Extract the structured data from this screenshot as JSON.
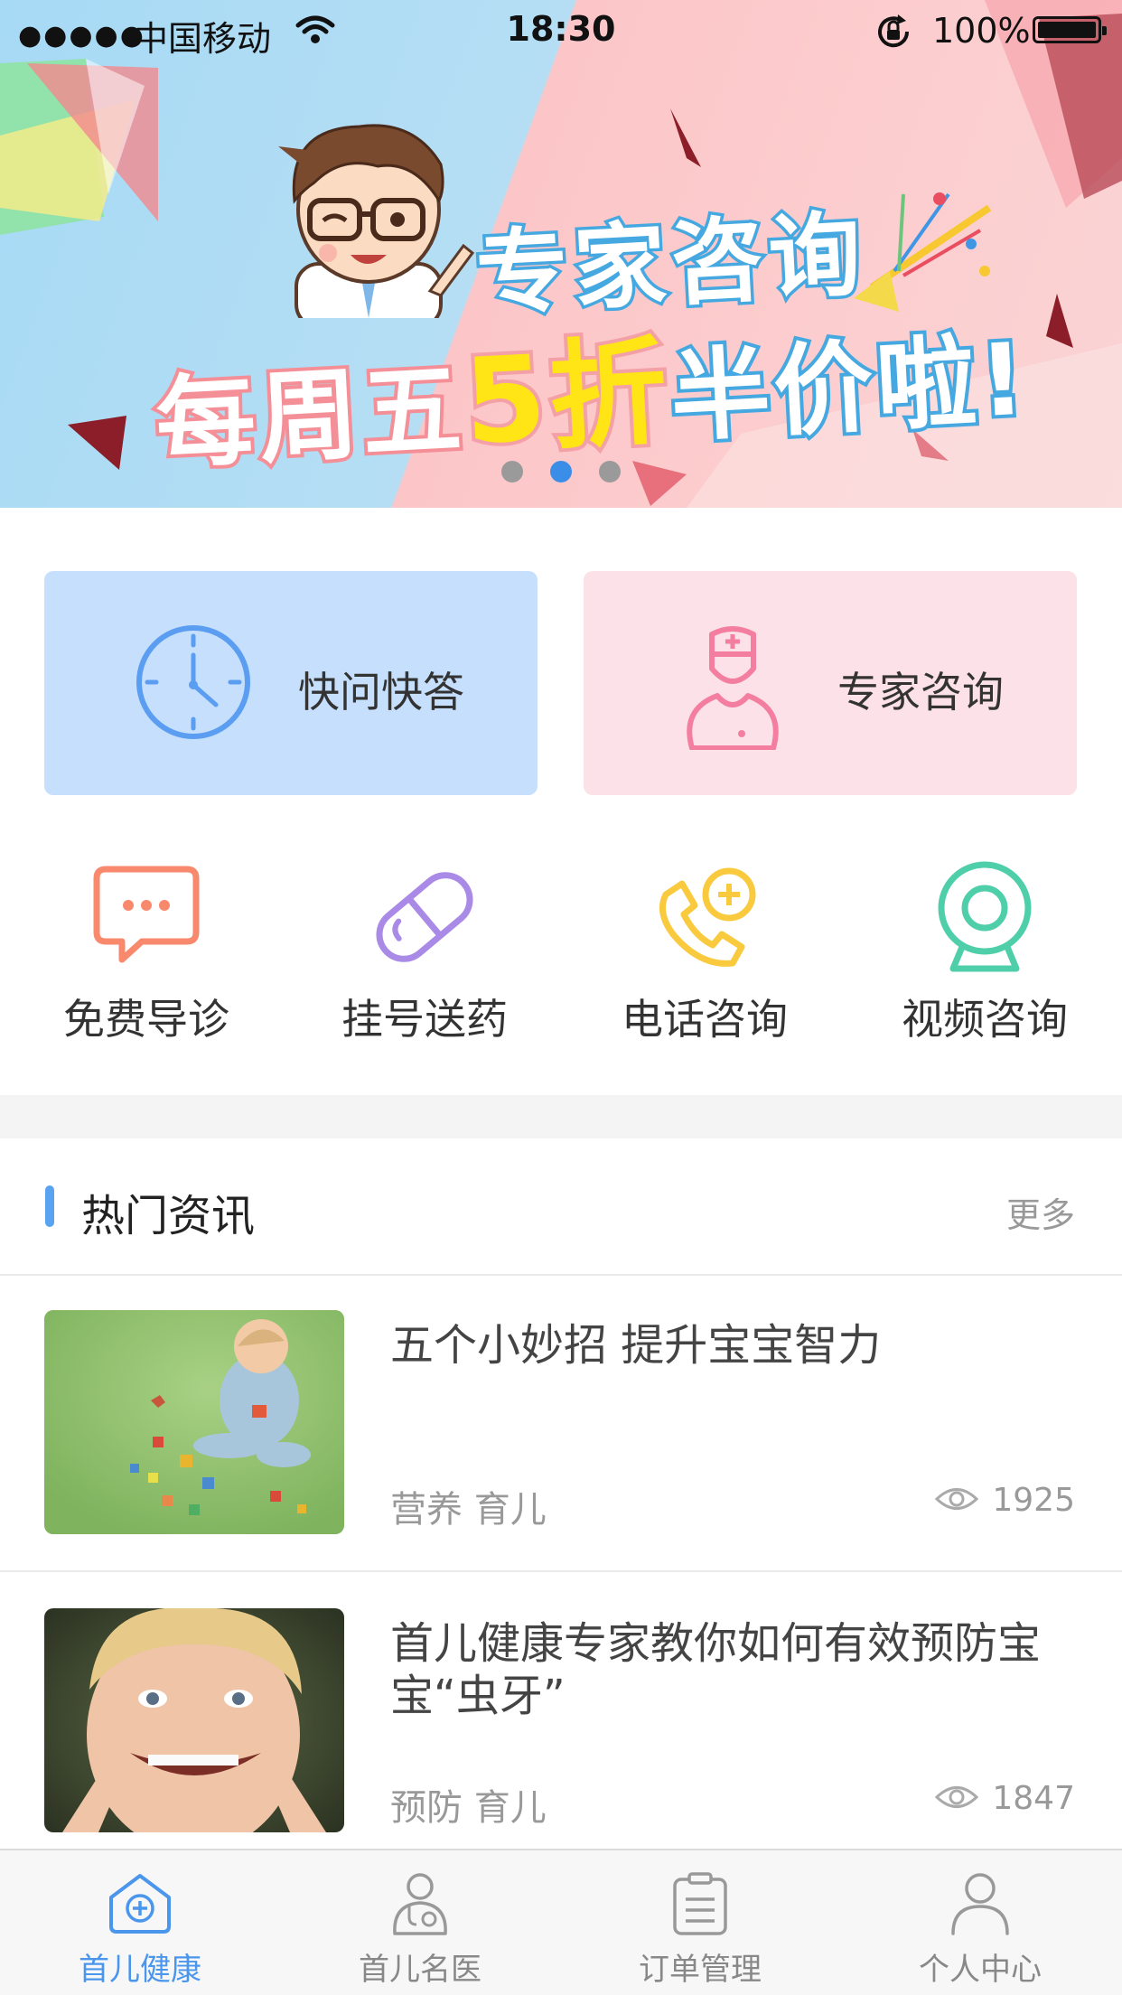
{
  "status_bar": {
    "signal": "●●●●●",
    "carrier": "中国移动",
    "time": "18:30",
    "battery": "100%"
  },
  "banner": {
    "line1": "专家咨询",
    "line2_part1": "每周五",
    "line2_part2": "5折",
    "line2_part3": "半价啦!",
    "page_count": 3,
    "active_page": 2
  },
  "main_cards": [
    {
      "label": "快问快答",
      "icon": "clock-icon",
      "color": "#5b9ef1"
    },
    {
      "label": "专家咨询",
      "icon": "nurse-icon",
      "color": "#f37ea0"
    }
  ],
  "quick_items": [
    {
      "label": "免费导诊",
      "icon": "chat-bubble-icon",
      "color": "#f8896d"
    },
    {
      "label": "挂号送药",
      "icon": "pill-icon",
      "color": "#a98ae6"
    },
    {
      "label": "电话咨询",
      "icon": "phone-plus-icon",
      "color": "#f9ca3e"
    },
    {
      "label": "视频咨询",
      "icon": "webcam-icon",
      "color": "#4fcfa9"
    }
  ],
  "news_section": {
    "title": "热门资讯",
    "more": "更多"
  },
  "news": [
    {
      "title": "五个小妙招 提升宝宝智力",
      "tags": "营养 育儿",
      "views": "1925"
    },
    {
      "title": "首儿健康专家教你如何有效预防宝宝“虫牙”",
      "tags": "预防 育儿",
      "views": "1847"
    }
  ],
  "tab_bar": {
    "tabs": [
      {
        "label": "首儿健康",
        "icon": "home-plus-icon",
        "active": true
      },
      {
        "label": "首儿名医",
        "icon": "doctor-icon",
        "active": false
      },
      {
        "label": "订单管理",
        "icon": "clipboard-icon",
        "active": false
      },
      {
        "label": "个人中心",
        "icon": "person-icon",
        "active": false
      }
    ],
    "active_color": "#4a96ec"
  }
}
